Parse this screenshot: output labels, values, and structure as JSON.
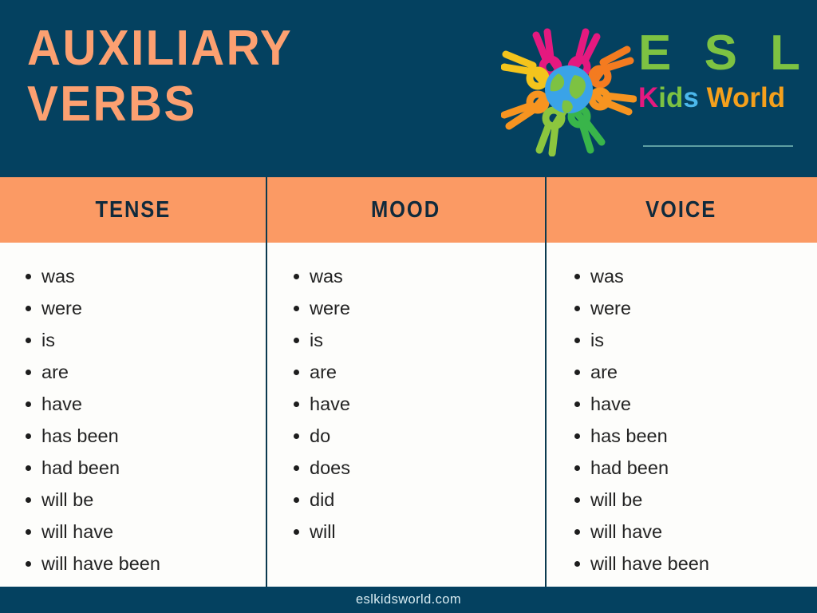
{
  "header": {
    "title_lines": [
      "AUXILIARY",
      "VERBS"
    ],
    "background_color": "#044160",
    "title_color": "#fca071"
  },
  "logo": {
    "mark_name": "esl-kids-world-globe-people-logo",
    "brand_top": "E S L",
    "brand_bottom_parts": {
      "k": "K",
      "i": "i",
      "d": "d",
      "s": "s",
      "space": " ",
      "w": "W",
      "rest": "orld"
    },
    "brand_bottom_full": "Kids World",
    "colors": {
      "esl_green": "#7dc242",
      "k_magenta": "#e5197f",
      "id_green": "#7dc242",
      "s_blue": "#4cb8ec",
      "world_orange": "#f5a01c",
      "globe_blue": "#3aa3e8",
      "globe_land_green": "#7dc242"
    }
  },
  "table": {
    "band_color": "#fb9a64",
    "band_text_color": "#102a3c",
    "divider_color": "#0b3a4f",
    "columns": [
      {
        "header": "TENSE",
        "items": [
          "was",
          "were",
          "is",
          "are",
          "have",
          "has been",
          "had been",
          "will be",
          "will have",
          "will have been"
        ]
      },
      {
        "header": "MOOD",
        "items": [
          "was",
          "were",
          "is",
          "are",
          "have",
          "do",
          "does",
          "did",
          "will"
        ]
      },
      {
        "header": "VOICE",
        "items": [
          "was",
          "were",
          "is",
          "are",
          "have",
          "has been",
          "had been",
          "will be",
          "will have",
          "will have been"
        ]
      }
    ]
  },
  "footer": {
    "text": "eslkidsworld.com",
    "background_color": "#044160",
    "text_color": "#d9ecf2"
  }
}
